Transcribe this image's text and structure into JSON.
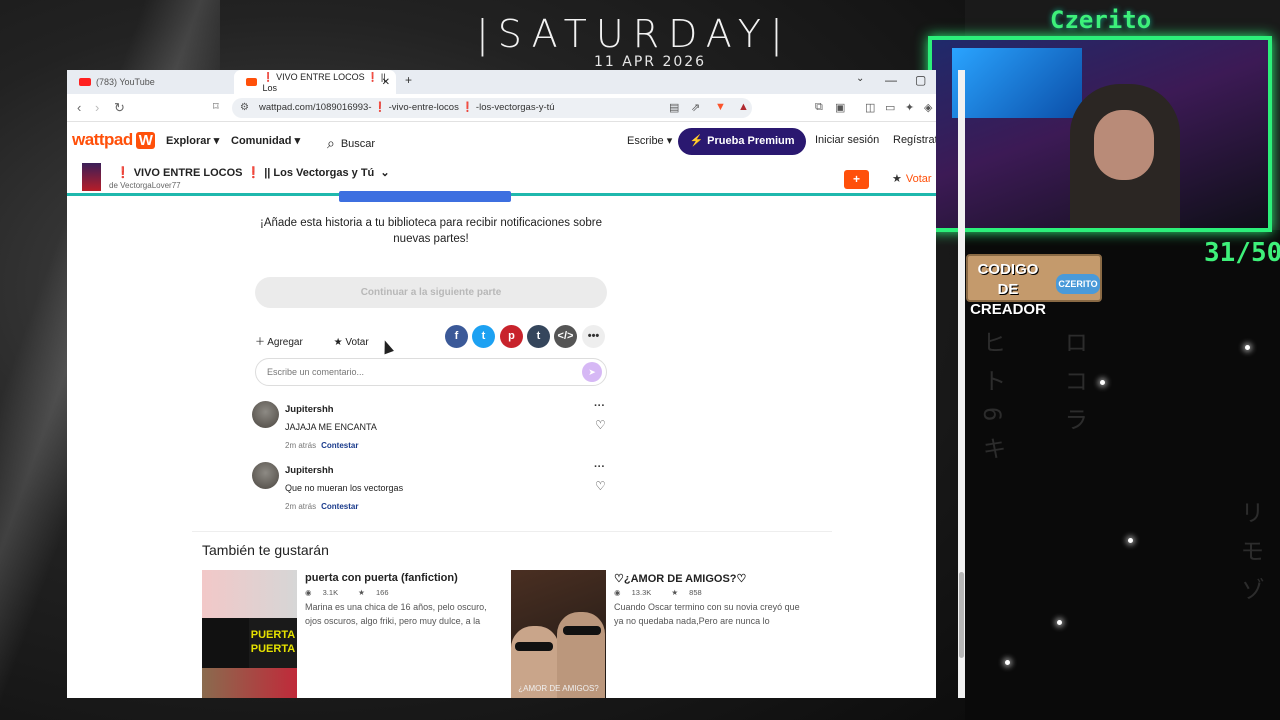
{
  "overlay": {
    "day": "|SATURDAY|",
    "date": "11 APR 2026",
    "streamer_name": "Czerito",
    "counter": "31/50",
    "creator_code_label": "CODIGO DE CREADOR",
    "creator_code_badge": "CZERITO",
    "accent_color": "#2cf07a"
  },
  "browser": {
    "tabs": [
      {
        "label": "(783) YouTube",
        "icon": "youtube-icon",
        "active": false
      },
      {
        "label": "❗ VIVO ENTRE LOCOS ❗ || Los",
        "icon": "wattpad-icon",
        "active": true
      }
    ],
    "new_tab": "+",
    "url": "wattpad.com/1089016993- ❗ -vivo-entre-locos ❗ -los-vectorgas-y-tú"
  },
  "wattpad": {
    "logo": "wattpad",
    "nav": {
      "explore": "Explorar",
      "community": "Comunidad",
      "search": "Buscar",
      "write": "Escribe",
      "premium": "Prueba Premium",
      "login": "Iniciar sesión",
      "register": "Regístrate"
    },
    "story": {
      "title": "VIVO ENTRE LOCOS",
      "title_suffix": "|| Los Vectorgas y Tú",
      "author": "de VectorgaLover77",
      "vote": "Votar",
      "plus": "+"
    },
    "notify_text": "¡Añade esta historia a tu biblioteca para recibir notificaciones sobre nuevas partes!",
    "continue_button": "Continuar a la siguiente parte",
    "actions": {
      "add": "Agregar",
      "vote": "Votar"
    },
    "comment_placeholder": "Escribe un comentario...",
    "comments": [
      {
        "user": "Jupitershh",
        "text": "JAJAJA ME ENCANTA",
        "time": "2m atrás",
        "reply": "Contestar"
      },
      {
        "user": "Jupitershh",
        "text": "Que no mueran los vectorgas",
        "time": "2m atrás",
        "reply": "Contestar"
      }
    ],
    "recommendations_title": "También te gustarán",
    "recommendations": [
      {
        "title": "puerta con puerta (fanfiction)",
        "reads": "3.1K",
        "votes": "166",
        "description": "Marina es una chica de 16 años, pelo oscuro, ojos oscuros, algo friki, pero muy dulce, a la",
        "cover_text": "PUERTA PUERTA"
      },
      {
        "title": "♡¿AMOR DE AMIGOS?♡",
        "reads": "13.3K",
        "votes": "858",
        "description": "Cuando Oscar termino con su novia creyó que ya no quedaba nada,Pero are nunca lo",
        "cover_text": "¿AMOR DE AMIGOS?"
      }
    ]
  }
}
